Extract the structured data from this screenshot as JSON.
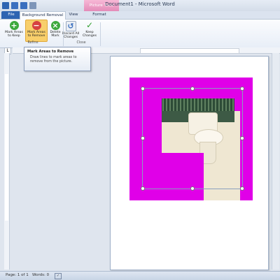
{
  "window": {
    "title": "Document1 - Microsoft Word"
  },
  "quick_access": [
    {
      "name": "word-app-icon",
      "color": "#2e64b2"
    },
    {
      "name": "save-icon",
      "color": "#3a6fbf"
    },
    {
      "name": "undo-icon",
      "color": "#3a6fbf"
    },
    {
      "name": "redo-icon",
      "color": "#7e95b8"
    }
  ],
  "context_tab_header": "Picture Tools",
  "tabs": {
    "file": "File",
    "background_removal": "Background Removal",
    "view": "View",
    "format": "Format"
  },
  "ribbon": {
    "mark_keep": "Mark Areas to Keep",
    "mark_remove": "Mark Areas to Remove",
    "delete_mark": "Delete Mark",
    "discard_changes": "Discard All Changes",
    "keep_changes": "Keep Changes",
    "group_refine": "Refine",
    "group_close": "Close"
  },
  "tooltip": {
    "title": "Mark Areas to Remove",
    "body": "Draw lines to mark areas to remove from the picture."
  },
  "status": {
    "page": "Page: 1 of 1",
    "words": "Words: 0"
  },
  "colors": {
    "removal_overlay": "#e000e8",
    "accent_file_tab": "#2e64b2",
    "context_tab": "#e48bb8",
    "active_button": "#f8cf6b"
  }
}
